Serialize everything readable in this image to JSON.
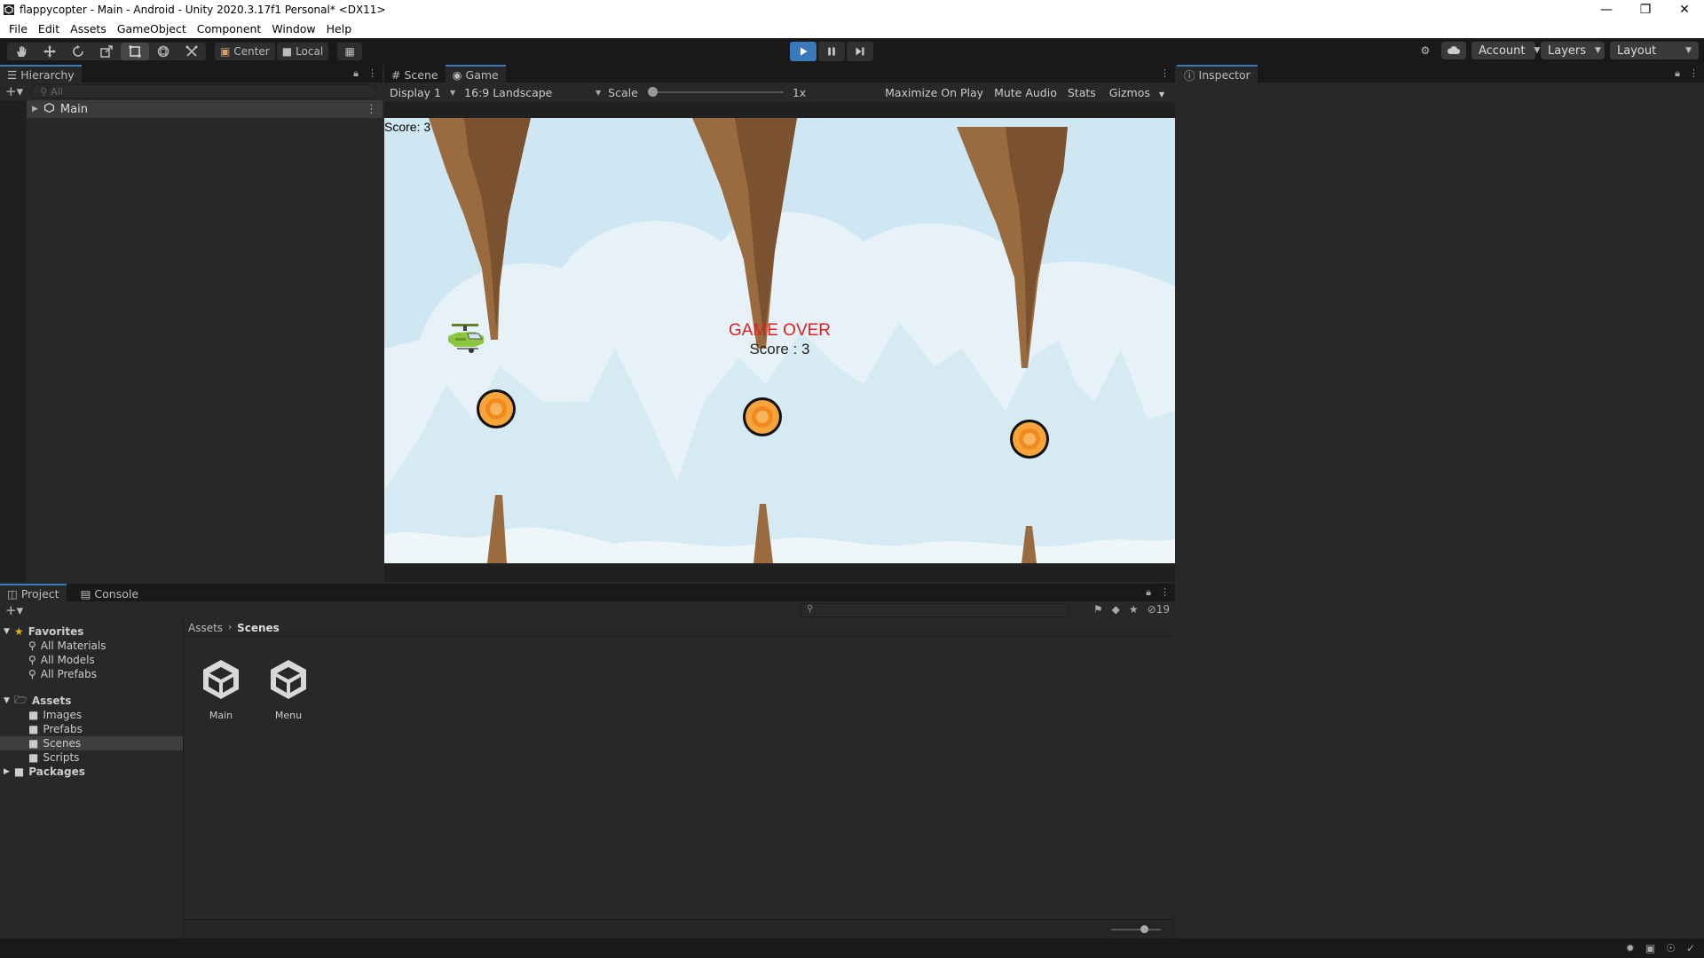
{
  "window": {
    "title": "flappycopter - Main - Android - Unity 2020.3.17f1 Personal* <DX11>"
  },
  "menu": [
    "File",
    "Edit",
    "Assets",
    "GameObject",
    "Component",
    "Window",
    "Help"
  ],
  "toolbar": {
    "center_label": "Center",
    "local_label": "Local",
    "account_label": "Account",
    "layers_label": "Layers",
    "layout_label": "Layout"
  },
  "hierarchy": {
    "tab_label": "Hierarchy",
    "search_placeholder": "All",
    "root_item": "Main"
  },
  "scene_tabs": {
    "scene": "Scene",
    "game": "Game"
  },
  "game_bar": {
    "display": "Display 1",
    "aspect": "16:9 Landscape",
    "scale_label": "Scale",
    "scale_value": "1x",
    "maximize": "Maximize On Play",
    "mute": "Mute Audio",
    "stats": "Stats",
    "gizmos": "Gizmos"
  },
  "game": {
    "score_hud": "Score: 3",
    "game_over": "GAME OVER",
    "final_score": "Score : 3",
    "colors": {
      "sky": "#cfe7f2",
      "rock": "#9a6b3e",
      "game_over": "#e02020"
    }
  },
  "inspector": {
    "tab_label": "Inspector"
  },
  "project": {
    "tab_project": "Project",
    "tab_console": "Console",
    "hidden_count": "19",
    "favorites_label": "Favorites",
    "favorites": [
      "All Materials",
      "All Models",
      "All Prefabs"
    ],
    "assets_label": "Assets",
    "asset_folders": [
      "Images",
      "Prefabs",
      "Scenes",
      "Scripts"
    ],
    "packages_label": "Packages",
    "breadcrumb": [
      "Assets",
      "Scenes"
    ],
    "items": [
      "Main",
      "Menu"
    ]
  }
}
